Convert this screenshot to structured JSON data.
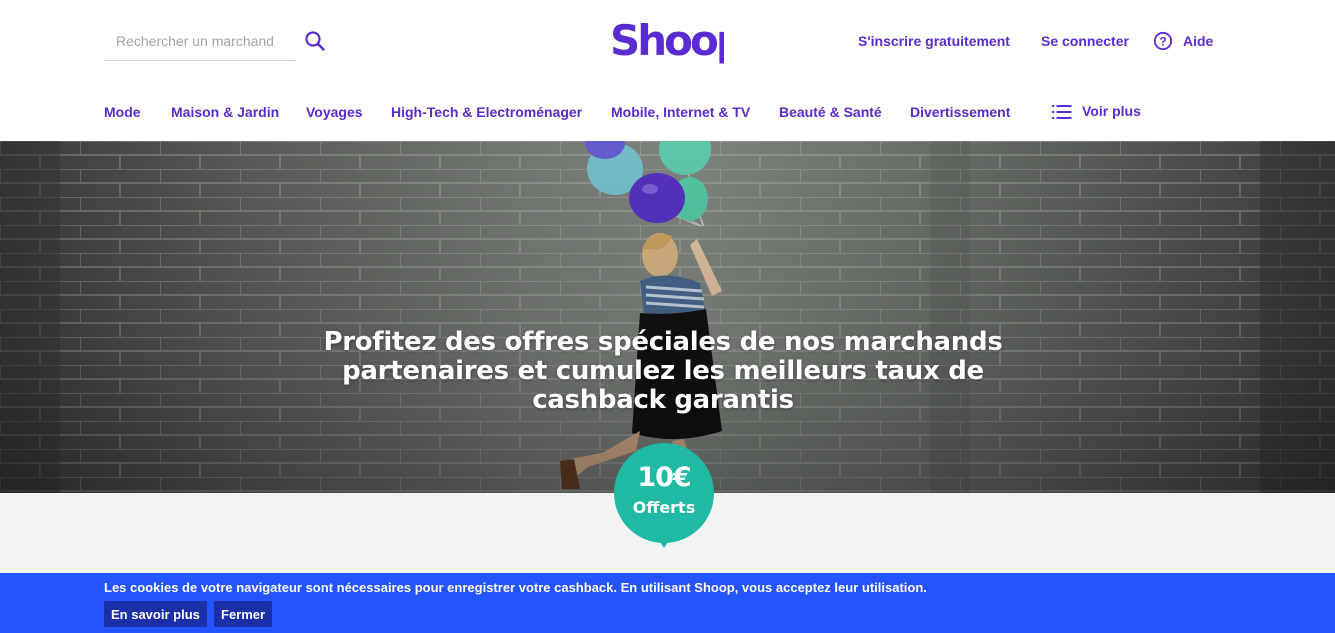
{
  "brand": {
    "logo_text": "Shoop",
    "accent": "#5a2bd1",
    "teal": "#1fb9a4",
    "cookie_blue": "#2454ff"
  },
  "search": {
    "placeholder": "Rechercher un marchand",
    "icon": "search-icon"
  },
  "header_links": {
    "signup": "S'inscrire gratuitement",
    "login": "Se connecter",
    "help": "Aide",
    "help_icon": "question-circle-icon"
  },
  "nav": {
    "items": [
      "Mode",
      "Maison & Jardin",
      "Voyages",
      "High-Tech & Electroménager",
      "Mobile, Internet & TV",
      "Beauté & Santé",
      "Divertissement"
    ],
    "more_label": "Voir plus",
    "more_icon": "list-icon"
  },
  "hero": {
    "title": "Profitez des offres spéciales de nos marchands partenaires et cumulez les meilleurs taux de cashback garantis"
  },
  "badge": {
    "amount": "10€",
    "label": "Offerts"
  },
  "cookie_bar": {
    "text": "Les cookies de votre navigateur sont nécessaires pour enregistrer votre cashback. En utilisant Shoop, vous acceptez leur utilisation.",
    "learn_more": "En savoir plus",
    "close": "Fermer"
  }
}
